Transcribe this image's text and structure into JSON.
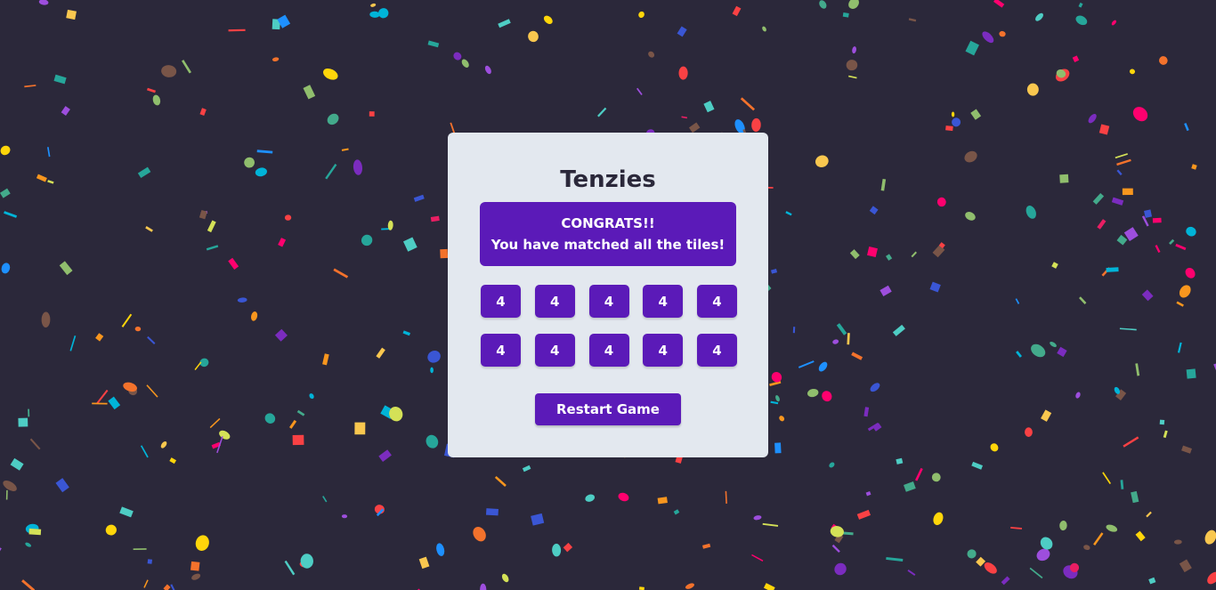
{
  "title": "Tenzies",
  "banner": {
    "line1": "CONGRATS!!",
    "line2": "You have matched all the tiles!"
  },
  "dice": [
    "4",
    "4",
    "4",
    "4",
    "4",
    "4",
    "4",
    "4",
    "4",
    "4"
  ],
  "restart_label": "Restart Game",
  "colors": {
    "background": "#2b283a",
    "card": "#e3e8ef",
    "accent": "#5b1ab8"
  }
}
